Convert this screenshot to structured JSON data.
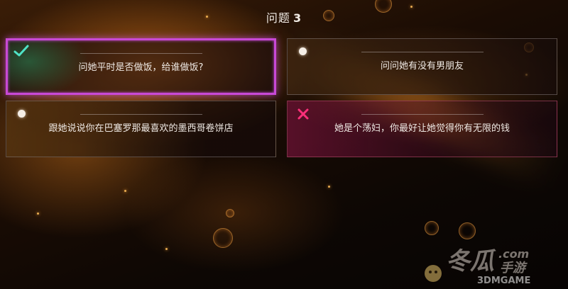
{
  "question": {
    "label": "问题",
    "number": "3"
  },
  "answers": [
    {
      "text": "问她平时是否做饭，给谁做饭?",
      "state": "selected-correct",
      "icon": "check-icon"
    },
    {
      "text": "问问她有没有男朋友",
      "state": "neutral",
      "icon": "dot-icon"
    },
    {
      "text": "跟她说说你在巴塞罗那最喜欢的墨西哥卷饼店",
      "state": "neutral",
      "icon": "dot-icon"
    },
    {
      "text": "她是个荡妇，你最好让她觉得你有无限的钱",
      "state": "wrong",
      "icon": "cross-icon"
    }
  ],
  "watermark": {
    "brand_cn": "冬瓜手游",
    "domain": ".com",
    "site": "3DMGAME"
  },
  "colors": {
    "highlight_border": "#c849d6",
    "check": "#4fe3c6",
    "cross": "#ff2f7a",
    "text": "#efe9e4"
  }
}
